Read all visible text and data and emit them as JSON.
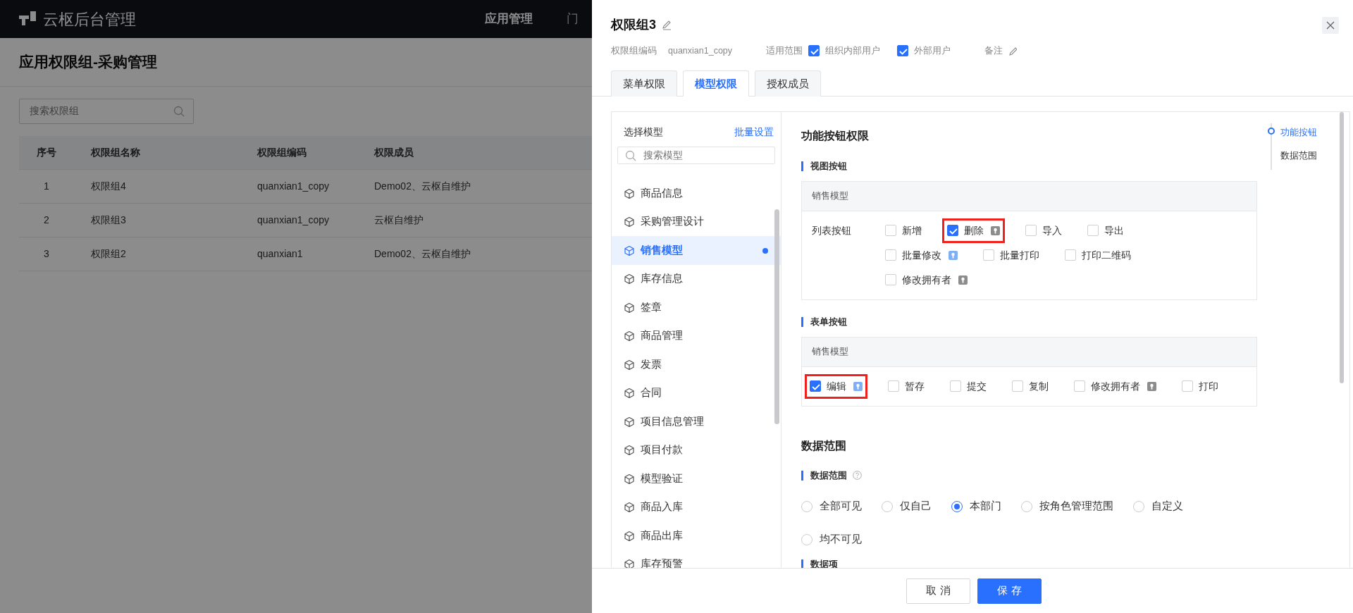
{
  "app": {
    "logo_text": "云枢后台管理",
    "nav": [
      {
        "label": "应用管理",
        "selected": true
      },
      {
        "label": "门",
        "selected": false
      }
    ]
  },
  "page": {
    "title": "应用权限组-采购管理",
    "search": {
      "placeholder": "搜索权限组"
    },
    "table": {
      "columns": [
        "序号",
        "权限组名称",
        "权限组编码",
        "权限成员"
      ],
      "rows": [
        [
          "1",
          "权限组4",
          "quanxian1_copy",
          "Demo02、云枢自维护"
        ],
        [
          "2",
          "权限组3",
          "quanxian1_copy",
          "云枢自维护"
        ],
        [
          "3",
          "权限组2",
          "quanxian1",
          "Demo02、云枢自维护"
        ]
      ]
    }
  },
  "drawer": {
    "title": "权限组3",
    "meta": {
      "code_label": "权限组编码",
      "code": "quanxian1_copy",
      "scope_label": "适用范围",
      "scopes": [
        {
          "label": "组织内部用户",
          "checked": true
        },
        {
          "label": "外部用户",
          "checked": true
        }
      ],
      "remark_label": "备注"
    },
    "tabs": [
      {
        "label": "菜单权限",
        "selected": false
      },
      {
        "label": "模型权限",
        "selected": true
      },
      {
        "label": "授权成员",
        "selected": false
      }
    ],
    "model_panel": {
      "title": "选择模型",
      "action": "批量设置",
      "search": {
        "placeholder": "搜索模型"
      },
      "items": [
        {
          "label": "商品信息",
          "selected": false,
          "modified": false
        },
        {
          "label": "采购管理设计",
          "selected": false,
          "modified": false
        },
        {
          "label": "销售模型",
          "selected": true,
          "modified": true
        },
        {
          "label": "库存信息",
          "selected": false,
          "modified": false
        },
        {
          "label": "签章",
          "selected": false,
          "modified": false
        },
        {
          "label": "商品管理",
          "selected": false,
          "modified": false
        },
        {
          "label": "发票",
          "selected": false,
          "modified": false
        },
        {
          "label": "合同",
          "selected": false,
          "modified": false
        },
        {
          "label": "项目信息管理",
          "selected": false,
          "modified": false
        },
        {
          "label": "项目付款",
          "selected": false,
          "modified": false
        },
        {
          "label": "模型验证",
          "selected": false,
          "modified": false
        },
        {
          "label": "商品入库",
          "selected": false,
          "modified": false
        },
        {
          "label": "商品出库",
          "selected": false,
          "modified": false
        },
        {
          "label": "库存预警",
          "selected": false,
          "modified": false
        }
      ]
    },
    "content": {
      "title": "功能按钮权限",
      "sections": [
        {
          "title": "视图按钮",
          "card_title": "销售模型",
          "row_label": "列表按钮",
          "lines": [
            [
              {
                "label": "新增",
                "checked": false,
                "highlighted": false
              },
              {
                "label": "删除",
                "checked": true,
                "highlighted": true,
                "lock": {
                  "color": "#8c8c8c"
                }
              },
              {
                "label": "导入",
                "checked": false,
                "highlighted": false
              },
              {
                "label": "导出",
                "checked": false,
                "highlighted": false
              }
            ],
            [
              {
                "label": "批量修改",
                "checked": false,
                "highlighted": false,
                "lock": {
                  "color": "#7fb0f5"
                }
              },
              {
                "label": "批量打印",
                "checked": false,
                "highlighted": false
              },
              {
                "label": "打印二维码",
                "checked": false,
                "highlighted": false
              }
            ],
            [
              {
                "label": "修改拥有者",
                "checked": false,
                "highlighted": false,
                "lock": {
                  "color": "#8c8c8c"
                }
              }
            ]
          ]
        },
        {
          "title": "表单按钮",
          "card_title": "销售模型",
          "lines": [
            [
              {
                "label": "编辑",
                "checked": true,
                "highlighted": true,
                "lock": {
                  "color": "#7fb0f5"
                }
              },
              {
                "label": "暂存",
                "checked": false,
                "highlighted": false
              },
              {
                "label": "提交",
                "checked": false,
                "highlighted": false
              },
              {
                "label": "复制",
                "checked": false,
                "highlighted": false
              },
              {
                "label": "修改拥有者",
                "checked": false,
                "highlighted": false,
                "lock": {
                  "color": "#8c8c8c"
                }
              },
              {
                "label": "打印",
                "checked": false,
                "highlighted": false
              }
            ]
          ]
        }
      ],
      "data_scope": {
        "title": "数据范围",
        "subtitle": "数据范围",
        "options": [
          {
            "label": "全部可见",
            "selected": false
          },
          {
            "label": "仅自己",
            "selected": false
          },
          {
            "label": "本部门",
            "selected": true
          },
          {
            "label": "按角色管理范围",
            "selected": false
          },
          {
            "label": "自定义",
            "selected": false
          },
          {
            "label": "均不可见",
            "selected": false
          }
        ]
      },
      "data_items_title": "数据项"
    },
    "anchors": [
      {
        "label": "功能按钮",
        "selected": true
      },
      {
        "label": "数据范围",
        "selected": false
      }
    ],
    "footer": {
      "buttons": [
        {
          "label": "取 消",
          "kind": "default"
        },
        {
          "label": "保 存",
          "kind": "primary"
        }
      ]
    }
  }
}
